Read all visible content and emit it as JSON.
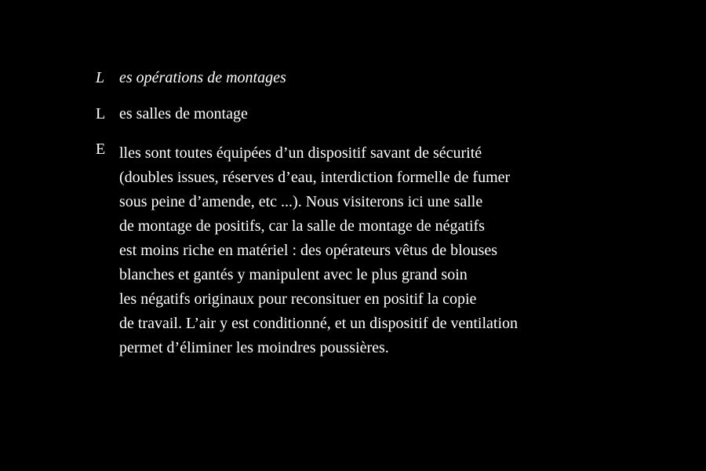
{
  "heading": {
    "initial": "L",
    "rest": "es opérations de montages"
  },
  "subheading": {
    "initial": "L",
    "rest": "es salles de montage"
  },
  "paragraph": {
    "initial": "E",
    "lines": [
      "lles sont toutes équipées d’un dispositif savant de sécurité",
      "(doubles issues, réserves d’eau, interdiction formelle de fumer",
      "sous peine d’amende, etc ...). Nous visiterons ici une salle",
      "de montage de positifs, car la salle de montage de négatifs",
      "est moins riche en matériel : des opérateurs vêtus de blouses",
      "blanches et gantés y manipulent avec le plus grand soin",
      "les négatifs originaux pour reconsituer en positif la copie",
      "de travail. L’air y est conditionné, et un dispositif de ventilation",
      "permet d’éliminer les moindres poussières."
    ]
  }
}
